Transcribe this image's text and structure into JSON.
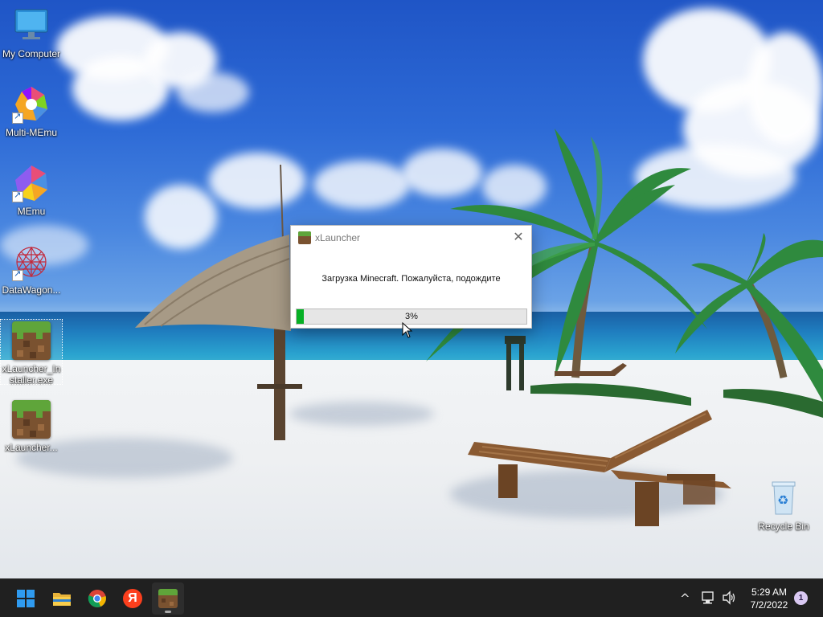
{
  "desktop": {
    "icons": [
      {
        "label": "My Computer",
        "icon": "monitor-icon"
      },
      {
        "label": "Multi-MEmu",
        "icon": "multi-memu-icon"
      },
      {
        "label": "MEmu",
        "icon": "memu-icon"
      },
      {
        "label": "DataWagon...",
        "icon": "datawagon-icon"
      },
      {
        "label": "xLauncher_In staller.exe",
        "icon": "minecraft-grass-block-icon"
      },
      {
        "label": "xLauncher...",
        "icon": "minecraft-grass-block-icon"
      },
      {
        "label": "Recycle Bin",
        "icon": "recycle-bin-icon"
      }
    ]
  },
  "dialog": {
    "title": "xLauncher",
    "close_symbol": "✕",
    "message": "Загрузка Minecraft. Пожалуйста, подождите",
    "progress": {
      "value": 0.03,
      "label": "3%"
    }
  },
  "taskbar": {
    "apps": [
      {
        "name": "Start",
        "icon": "windows-start-icon"
      },
      {
        "name": "File Explorer",
        "icon": "folder-icon"
      },
      {
        "name": "Google Chrome",
        "icon": "chrome-icon"
      },
      {
        "name": "Yandex Browser",
        "icon": "yandex-icon",
        "glyph": "Я"
      },
      {
        "name": "xLauncher",
        "icon": "minecraft-grass-block-icon",
        "active": true
      }
    ],
    "tray": {
      "chevron": "^",
      "time": "5:29 AM",
      "date": "7/2/2022",
      "notification_count": "1"
    }
  },
  "colors": {
    "progress_green": "#06b025",
    "taskbar_bg": "#202020",
    "notification_badge": "#d9c8f2"
  }
}
